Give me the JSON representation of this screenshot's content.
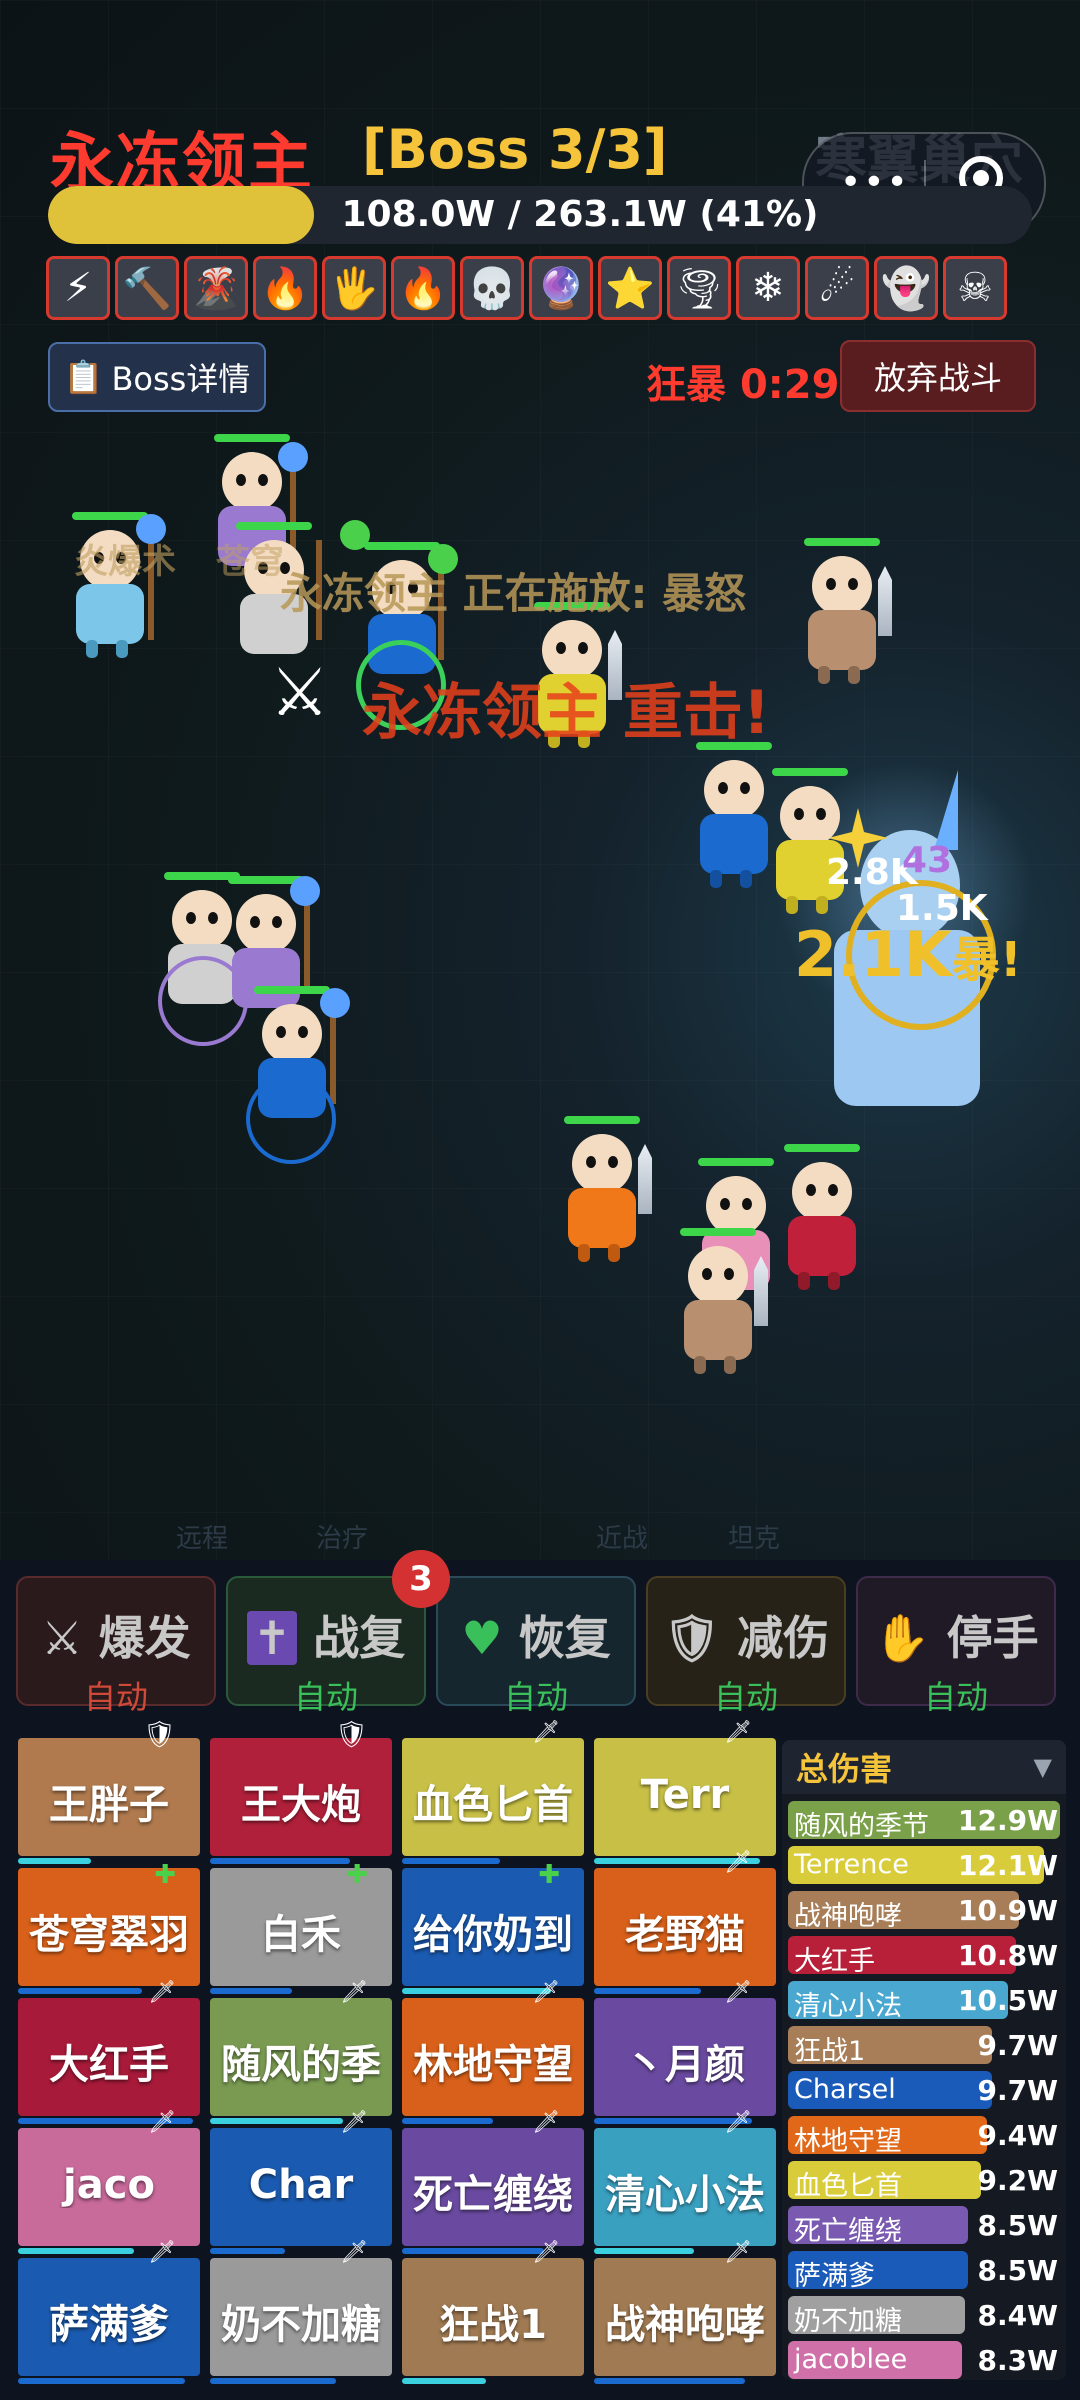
{
  "boss": {
    "name": "永冻领主",
    "stage": "[Boss 3/3]",
    "lair": "寒翼巢穴",
    "hp_text": "108.0W / 263.1W (41%)",
    "hp_fraction": 0.41
  },
  "buffs": [
    "⚡",
    "🔨",
    "🌋",
    "🔥",
    "🖐",
    "🔥",
    "💀",
    "🔮",
    "⭐",
    "🌪",
    "❄",
    "☄",
    "👻",
    "☠"
  ],
  "controls": {
    "boss_detail": "Boss详情",
    "rage_label": "狂暴",
    "rage_timer": "0:29",
    "abandon": "放弃战斗",
    "capsule_dots": "•••"
  },
  "battle_text": {
    "cast": "永冻领主 正在施放: 暴怒",
    "crit": "永冻领主 重击!",
    "skill_fade": "炎爆术",
    "skill_fade2": "苍穹",
    "dmg1": "2.8K",
    "dmg2": "1.5K",
    "dmg3": "2.1K",
    "dmg_hit": "暴!",
    "dmg4": "43"
  },
  "lanes": [
    "远程",
    "治疗",
    "近战",
    "坦克"
  ],
  "skills": [
    {
      "icon": "⚔",
      "name": "爆发",
      "auto": "自动"
    },
    {
      "icon": "✝",
      "name": "战复",
      "auto": "自动"
    },
    {
      "icon": "♥",
      "name": "恢复",
      "auto": "自动"
    },
    {
      "icon": "🛡",
      "name": "减伤",
      "auto": "自动"
    },
    {
      "icon": "✋",
      "name": "停手",
      "auto": "自动"
    }
  ],
  "skill_badge": "3",
  "slots": [
    {
      "name": "王胖子",
      "color": "#b07a4e"
    },
    {
      "name": "王大炮",
      "color": "#b0203a"
    },
    {
      "name": "血色匕首",
      "color": "#c8c046"
    },
    {
      "name": "Terr",
      "color": "#c8c046"
    },
    {
      "name": "苍穹翠羽",
      "color": "#d8601a"
    },
    {
      "name": "白禾",
      "color": "#9a9a9a"
    },
    {
      "name": "给你奶到",
      "color": "#1a5ab0"
    },
    {
      "name": "老野猫",
      "color": "#d8601a"
    },
    {
      "name": "大红手",
      "color": "#a81a3a"
    },
    {
      "name": "随风的季",
      "color": "#7a9a52"
    },
    {
      "name": "林地守望",
      "color": "#d8601a"
    },
    {
      "name": "丶月颜",
      "color": "#6a4aa0"
    },
    {
      "name": "jaco",
      "color": "#c86a9a"
    },
    {
      "name": "Char",
      "color": "#1a5ab0"
    },
    {
      "name": "死亡缠绕",
      "color": "#6a4aa0"
    },
    {
      "name": "清心小法",
      "color": "#3aa0c0"
    },
    {
      "name": "萨满爹",
      "color": "#1a5ab0"
    },
    {
      "name": "奶不加糖",
      "color": "#9a9a9a"
    },
    {
      "name": "狂战1",
      "color": "#a07a52"
    },
    {
      "name": "战神咆哮",
      "color": "#a07a52"
    }
  ],
  "damage": {
    "header": "总伤害",
    "rows": [
      {
        "name": "随风的季节",
        "value": "12.9W",
        "color": "#7aa04a",
        "fraction": 1.0
      },
      {
        "name": "Terrence",
        "value": "12.1W",
        "color": "#d8cc3a",
        "fraction": 0.94
      },
      {
        "name": "战神咆哮",
        "value": "10.9W",
        "color": "#a87e58",
        "fraction": 0.85
      },
      {
        "name": "大红手",
        "value": "10.8W",
        "color": "#b8203a",
        "fraction": 0.84
      },
      {
        "name": "清心小法",
        "value": "10.5W",
        "color": "#4aa8d0",
        "fraction": 0.81
      },
      {
        "name": "狂战1",
        "value": "9.7W",
        "color": "#a87e58",
        "fraction": 0.75
      },
      {
        "name": "Charsel",
        "value": "9.7W",
        "color": "#1a5ab8",
        "fraction": 0.75
      },
      {
        "name": "林地守望",
        "value": "9.4W",
        "color": "#e06818",
        "fraction": 0.73
      },
      {
        "name": "血色匕首",
        "value": "9.2W",
        "color": "#d8cc3a",
        "fraction": 0.71
      },
      {
        "name": "死亡缠绕",
        "value": "8.5W",
        "color": "#7a5ab0",
        "fraction": 0.66
      },
      {
        "name": "萨满爹",
        "value": "8.5W",
        "color": "#1a5ab8",
        "fraction": 0.66
      },
      {
        "name": "奶不加糖",
        "value": "8.4W",
        "color": "#a0a0a0",
        "fraction": 0.65
      },
      {
        "name": "jacoblee",
        "value": "8.3W",
        "color": "#d070a8",
        "fraction": 0.64
      }
    ]
  }
}
